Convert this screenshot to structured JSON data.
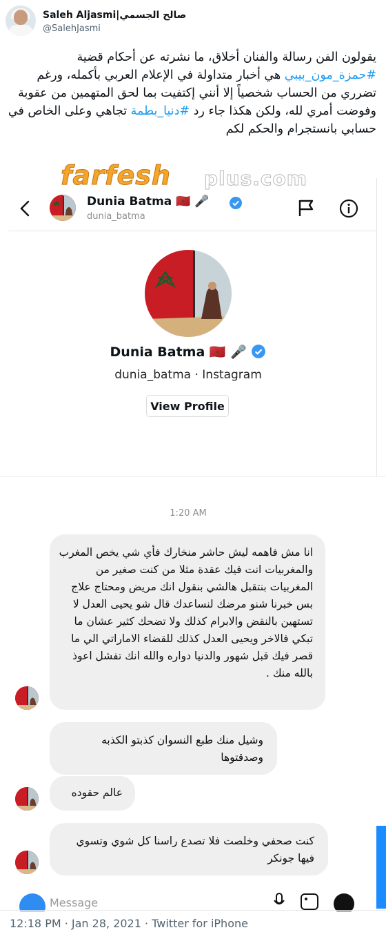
{
  "tweet": {
    "author_name": "Saleh Aljasmi|صالح الجسمي",
    "author_handle": "@SalehJasmi",
    "text_part1": "يقولون الفن رسالة والفنان أخلاق، ما نشرته عن أحكام قضية ",
    "hashtag1": "#حمزة_مون_بيبي",
    "text_part2": " هي أخبار متداولة في الإعلام العربي بأكمله، ورغم تضرري من الحساب شخصياً إلا أنني إكتفيت بما لحق المتهمين من عقوبة وفوضت أمري لله، ولكن هكذا جاء رد ",
    "hashtag2": "#دنيا_بطمة",
    "text_part3": " تجاهي وعلى الخاص في حسابي بانستجرام والحكم لكم",
    "timestamp": "12:18 PM · Jan 28, 2021 · Twitter for iPhone"
  },
  "watermark": {
    "part1": "farfesh",
    "part2": "plus.com"
  },
  "instagram": {
    "header_name": "Dunia Batma 🇲🇦 🎤",
    "header_username": "dunia_batma",
    "profile_name": "Dunia Batma 🇲🇦 🎤",
    "profile_sub": "dunia_batma · Instagram",
    "view_profile_label": "View Profile",
    "chat_time": "1:20 AM",
    "message_placeholder": "Message",
    "messages": [
      "انا مش فاهمه ليش حاشر منخارك فأي شي يخص المغرب والمغربيات انت فيك عقدة مثلا من كنت صغير من المغربيات بنتقبل هالشي بنقول انك مريض ومحتاج علاج بس خبرنا شنو مرضك لنساعدك قال شو يحيى العدل لا تستهين بالنقض والابرام كذلك ولا تضحك كثير عشان ما تبكي فالاخر ويحيى العدل كذلك للقضاء الاماراتي الي ما قصر فيك قبل شهور والدنيا دواره والله انك تفشل اعوذ بالله منك .",
      "وشيل منك طبع النسوان كذبتو الكذبه وصدقتوها",
      "عالم حقوده",
      "كنت صحفي وخلصت فلا تصدع راسنا كل شوي وتسوي فيها جونكر"
    ]
  },
  "colors": {
    "twitter_blue": "#1d9bf0",
    "verified_blue": "#3897f0",
    "bubble_gray": "#efefef"
  }
}
